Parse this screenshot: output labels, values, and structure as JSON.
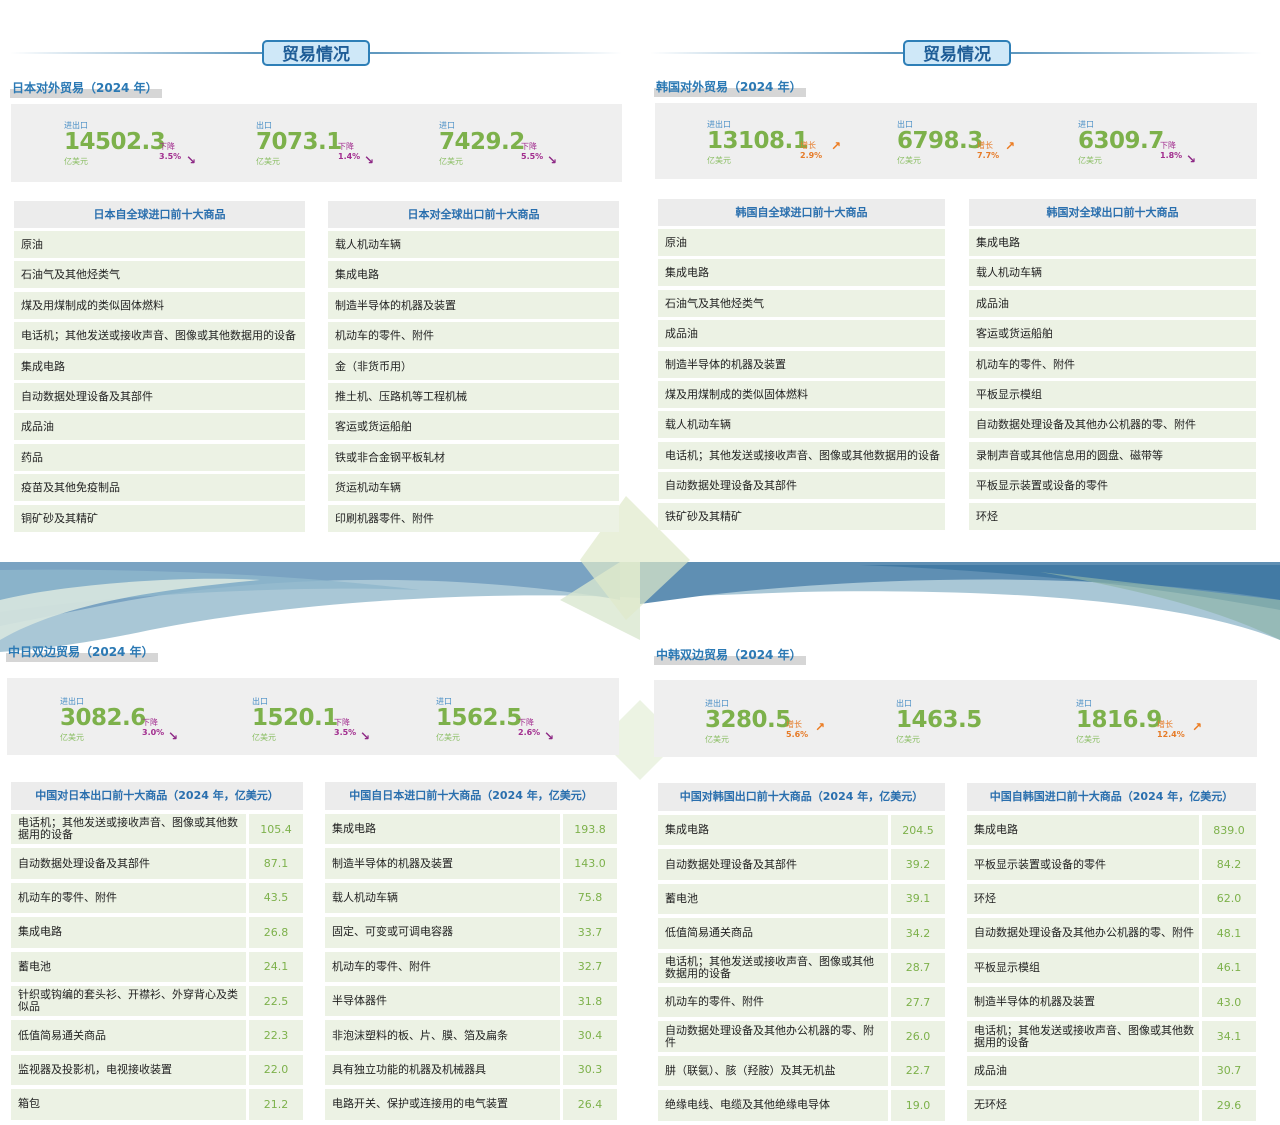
{
  "banner_title": "贸易情况",
  "japan_trade": {
    "title": "日本对外贸易（2024 年）",
    "stats": [
      {
        "label": "进出口",
        "value": "14502.3",
        "unit": "亿美元",
        "trend": "下降",
        "pct": "3.5%",
        "direction": "down"
      },
      {
        "label": "出口",
        "value": "7073.1",
        "unit": "亿美元",
        "trend": "下降",
        "pct": "1.4%",
        "direction": "down"
      },
      {
        "label": "进口",
        "value": "7429.2",
        "unit": "亿美元",
        "trend": "下降",
        "pct": "5.5%",
        "direction": "down"
      }
    ],
    "import_title": "日本自全球进口前十大商品",
    "imports": [
      "原油",
      "石油气及其他烃类气",
      "煤及用煤制成的类似固体燃料",
      "电话机；其他发送或接收声音、图像或其他数据用的设备",
      "集成电路",
      "自动数据处理设备及其部件",
      "成品油",
      "药品",
      "疫苗及其他免疫制品",
      "铜矿砂及其精矿"
    ],
    "export_title": "日本对全球出口前十大商品",
    "exports": [
      "载人机动车辆",
      "集成电路",
      "制造半导体的机器及装置",
      "机动车的零件、附件",
      "金（非货币用）",
      "推土机、压路机等工程机械",
      "客运或货运船舶",
      "铁或非合金钢平板轧材",
      "货运机动车辆",
      "印刷机器零件、附件"
    ]
  },
  "korea_trade": {
    "title": "韩国对外贸易（2024 年）",
    "stats": [
      {
        "label": "进出口",
        "value": "13108.1",
        "unit": "亿美元",
        "trend": "增长",
        "pct": "2.9%",
        "direction": "up"
      },
      {
        "label": "出口",
        "value": "6798.3",
        "unit": "亿美元",
        "trend": "增长",
        "pct": "7.7%",
        "direction": "up"
      },
      {
        "label": "进口",
        "value": "6309.7",
        "unit": "亿美元",
        "trend": "下降",
        "pct": "1.8%",
        "direction": "down"
      }
    ],
    "import_title": "韩国自全球进口前十大商品",
    "imports": [
      "原油",
      "集成电路",
      "石油气及其他烃类气",
      "成品油",
      "制造半导体的机器及装置",
      "煤及用煤制成的类似固体燃料",
      "载人机动车辆",
      "电话机；其他发送或接收声音、图像或其他数据用的设备",
      "自动数据处理设备及其部件",
      "铁矿砂及其精矿"
    ],
    "export_title": "韩国对全球出口前十大商品",
    "exports": [
      "集成电路",
      "载人机动车辆",
      "成品油",
      "客运或货运船舶",
      "机动车的零件、附件",
      "平板显示模组",
      "自动数据处理设备及其他办公机器的零、附件",
      "录制声音或其他信息用的圆盘、磁带等",
      "平板显示装置或设备的零件",
      "环烃"
    ]
  },
  "china_japan": {
    "title": "中日双边贸易（2024 年）",
    "stats": [
      {
        "label": "进出口",
        "value": "3082.6",
        "unit": "亿美元",
        "trend": "下降",
        "pct": "3.0%",
        "direction": "down"
      },
      {
        "label": "出口",
        "value": "1520.1",
        "unit": "亿美元",
        "trend": "下降",
        "pct": "3.5%",
        "direction": "down"
      },
      {
        "label": "进口",
        "value": "1562.5",
        "unit": "亿美元",
        "trend": "下降",
        "pct": "2.6%",
        "direction": "down"
      }
    ],
    "export_title": "中国对日本出口前十大商品（2024 年，亿美元）",
    "exports": [
      {
        "name": "电话机；其他发送或接收声音、图像或其他数据用的设备",
        "value": "105.4"
      },
      {
        "name": "自动数据处理设备及其部件",
        "value": "87.1"
      },
      {
        "name": "机动车的零件、附件",
        "value": "43.5"
      },
      {
        "name": "集成电路",
        "value": "26.8"
      },
      {
        "name": "蓄电池",
        "value": "24.1"
      },
      {
        "name": "针织或钩编的套头衫、开襟衫、外穿背心及类似品",
        "value": "22.5"
      },
      {
        "name": "低值简易通关商品",
        "value": "22.3"
      },
      {
        "name": "监视器及投影机，电视接收装置",
        "value": "22.0"
      },
      {
        "name": "箱包",
        "value": "21.2"
      }
    ],
    "import_title": "中国自日本进口前十大商品（2024 年，亿美元）",
    "imports": [
      {
        "name": "集成电路",
        "value": "193.8"
      },
      {
        "name": "制造半导体的机器及装置",
        "value": "143.0"
      },
      {
        "name": "载人机动车辆",
        "value": "75.8"
      },
      {
        "name": "固定、可变或可调电容器",
        "value": "33.7"
      },
      {
        "name": "机动车的零件、附件",
        "value": "32.7"
      },
      {
        "name": "半导体器件",
        "value": "31.8"
      },
      {
        "name": "非泡沫塑料的板、片、膜、箔及扁条",
        "value": "30.4"
      },
      {
        "name": "具有独立功能的机器及机械器具",
        "value": "30.3"
      },
      {
        "name": "电路开关、保护或连接用的电气装置",
        "value": "26.4"
      }
    ]
  },
  "china_korea": {
    "title": "中韩双边贸易（2024 年）",
    "stats": [
      {
        "label": "进出口",
        "value": "3280.5",
        "unit": "亿美元",
        "trend": "增长",
        "pct": "5.6%",
        "direction": "up"
      },
      {
        "label": "出口",
        "value": "1463.5",
        "unit": "亿美元",
        "trend": "",
        "pct": "",
        "direction": "none"
      },
      {
        "label": "进口",
        "value": "1816.9",
        "unit": "亿美元",
        "trend": "增长",
        "pct": "12.4%",
        "direction": "up"
      }
    ],
    "export_title": "中国对韩国出口前十大商品（2024 年，亿美元）",
    "exports": [
      {
        "name": "集成电路",
        "value": "204.5"
      },
      {
        "name": "自动数据处理设备及其部件",
        "value": "39.2"
      },
      {
        "name": "蓄电池",
        "value": "39.1"
      },
      {
        "name": "低值简易通关商品",
        "value": "34.2"
      },
      {
        "name": "电话机；其他发送或接收声音、图像或其他数据用的设备",
        "value": "28.7"
      },
      {
        "name": "机动车的零件、附件",
        "value": "27.7"
      },
      {
        "name": "自动数据处理设备及其他办公机器的零、附件",
        "value": "26.0"
      },
      {
        "name": "肼（联氨）、胲（羟胺）及其无机盐",
        "value": "22.7"
      },
      {
        "name": "绝缘电线、电缆及其他绝缘电导体",
        "value": "19.0"
      }
    ],
    "import_title": "中国自韩国进口前十大商品（2024 年，亿美元）",
    "imports": [
      {
        "name": "集成电路",
        "value": "839.0"
      },
      {
        "name": "平板显示装置或设备的零件",
        "value": "84.2"
      },
      {
        "name": "环烃",
        "value": "62.0"
      },
      {
        "name": "自动数据处理设备及其他办公机器的零、附件",
        "value": "48.1"
      },
      {
        "name": "平板显示模组",
        "value": "46.1"
      },
      {
        "name": "制造半导体的机器及装置",
        "value": "43.0"
      },
      {
        "name": "电话机；其他发送或接收声音、图像或其他数据用的设备",
        "value": "34.1"
      },
      {
        "name": "成品油",
        "value": "30.7"
      },
      {
        "name": "无环烃",
        "value": "29.6"
      }
    ]
  },
  "colors": {
    "accent_blue": "#2b79b4",
    "value_green": "#7db14b",
    "down_purple": "#a22e8f",
    "up_orange": "#e67b28"
  }
}
